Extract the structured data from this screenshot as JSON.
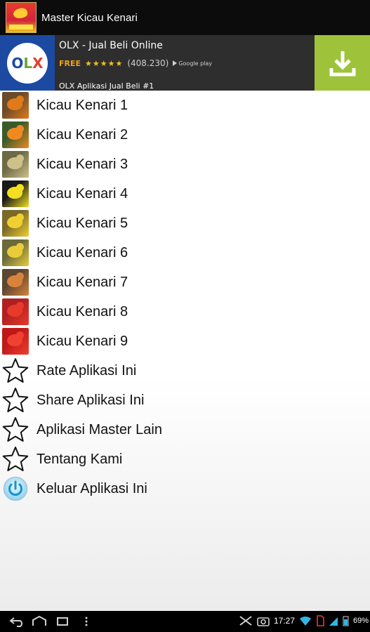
{
  "app": {
    "title": "Master Kicau Kenari"
  },
  "ad": {
    "title": "OLX - Jual Beli Online",
    "free_label": "FREE",
    "stars": "★★★★★",
    "rating_count": "(408.230)",
    "store_label": "Google play",
    "description": "OLX Aplikasi Jual Beli #1",
    "logo_letters": [
      "O",
      "L",
      "X"
    ]
  },
  "menu": {
    "items": [
      {
        "label": "Kicau Kenari 1",
        "icon": "canary-thumbnail-icon",
        "colors": [
          "#6a4a2a",
          "#e07a1a"
        ]
      },
      {
        "label": "Kicau Kenari 2",
        "icon": "canary-thumbnail-icon",
        "colors": [
          "#3a5a2a",
          "#f08a20"
        ]
      },
      {
        "label": "Kicau Kenari 3",
        "icon": "canary-thumbnail-icon",
        "colors": [
          "#6d6a45",
          "#cfc08a"
        ]
      },
      {
        "label": "Kicau Kenari 4",
        "icon": "canary-thumbnail-icon",
        "colors": [
          "#1a1a1a",
          "#f2e020"
        ]
      },
      {
        "label": "Kicau Kenari 5",
        "icon": "canary-thumbnail-icon",
        "colors": [
          "#7a6a2a",
          "#f0d030"
        ]
      },
      {
        "label": "Kicau Kenari 6",
        "icon": "canary-thumbnail-icon",
        "colors": [
          "#6a6a3a",
          "#e8cc3a"
        ]
      },
      {
        "label": "Kicau Kenari 7",
        "icon": "canary-thumbnail-icon",
        "colors": [
          "#5a4632",
          "#d9823a"
        ]
      },
      {
        "label": "Kicau Kenari 8",
        "icon": "canary-thumbnail-icon",
        "colors": [
          "#b02020",
          "#e83a2a"
        ]
      },
      {
        "label": "Kicau Kenari 9",
        "icon": "canary-thumbnail-icon",
        "colors": [
          "#c01818",
          "#f04030"
        ]
      },
      {
        "label": "Rate Aplikasi Ini",
        "icon": "star-icon"
      },
      {
        "label": "Share Aplikasi Ini",
        "icon": "star-icon"
      },
      {
        "label": "Aplikasi Master Lain",
        "icon": "star-icon"
      },
      {
        "label": "Tentang Kami",
        "icon": "star-icon"
      },
      {
        "label": "Keluar Aplikasi Ini",
        "icon": "power-icon"
      }
    ]
  },
  "status_bar": {
    "time": "17:27",
    "battery": "69%"
  },
  "colors": {
    "action_bar": "#0c0c0c",
    "ad_background": "#2e2e2e",
    "download_button": "#9ec33a",
    "free_label": "#f2a418"
  }
}
